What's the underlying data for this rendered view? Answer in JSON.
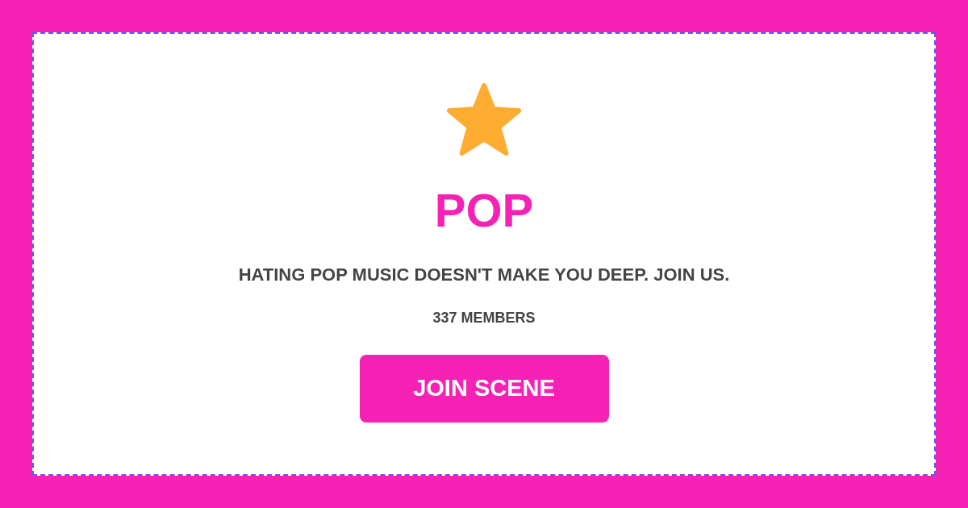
{
  "scene": {
    "title": "POP",
    "tagline": "HATING POP MUSIC DOESN'T MAKE YOU DEEP. JOIN US.",
    "members": "337 MEMBERS"
  },
  "button": {
    "label": "JOIN SCENE"
  }
}
